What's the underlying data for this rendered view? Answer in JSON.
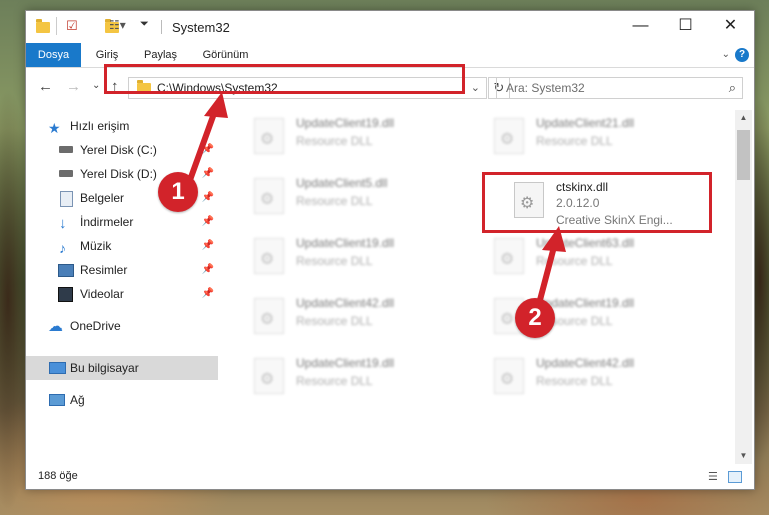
{
  "window": {
    "title": "System32",
    "controls": {
      "minimize": "—",
      "maximize": "☐",
      "close": "✕"
    }
  },
  "ribbon": {
    "tabs": [
      {
        "label": "Dosya",
        "active": true
      },
      {
        "label": "Giriş",
        "active": false
      },
      {
        "label": "Paylaş",
        "active": false
      },
      {
        "label": "Görünüm",
        "active": false
      }
    ],
    "help": "?"
  },
  "nav": {
    "address": "C:\\Windows\\System32",
    "search_placeholder": "Ara: System32"
  },
  "sidebar": {
    "items": [
      {
        "label": "Hızlı erişim",
        "icon": "star-icon",
        "pinned": false
      },
      {
        "label": "Yerel Disk (C:)",
        "icon": "drive-icon",
        "pinned": true
      },
      {
        "label": "Yerel Disk (D:)",
        "icon": "drive-icon",
        "pinned": true
      },
      {
        "label": "Belgeler",
        "icon": "document-icon",
        "pinned": true
      },
      {
        "label": "İndirmeler",
        "icon": "download-icon",
        "pinned": true
      },
      {
        "label": "Müzik",
        "icon": "music-icon",
        "pinned": true
      },
      {
        "label": "Resimler",
        "icon": "pictures-icon",
        "pinned": true
      },
      {
        "label": "Videolar",
        "icon": "video-icon",
        "pinned": true
      },
      {
        "label": "OneDrive",
        "icon": "cloud-icon",
        "pinned": false
      },
      {
        "label": "Bu bilgisayar",
        "icon": "computer-icon",
        "pinned": false,
        "selected": true
      },
      {
        "label": "Ağ",
        "icon": "network-icon",
        "pinned": false
      }
    ]
  },
  "files": [
    {
      "name": "UpdateClient19.dll",
      "type": "Resource DLL",
      "blurred": true
    },
    {
      "name": "UpdateClient21.dll",
      "type": "Resource DLL",
      "blurred": true
    },
    {
      "name": "UpdateClient5.dll",
      "type": "Resource DLL",
      "blurred": true
    },
    {
      "name": "ctskinx.dll",
      "version": "2.0.12.0",
      "description": "Creative SkinX Engi...",
      "blurred": false,
      "highlighted": true
    },
    {
      "name": "UpdateClient19.dll",
      "type": "Resource DLL",
      "blurred": true
    },
    {
      "name": "UpdateClient63.dll",
      "type": "Resource DLL",
      "blurred": true
    },
    {
      "name": "UpdateClient42.dll",
      "type": "Resource DLL",
      "blurred": true
    },
    {
      "name": "UpdateClient19.dll",
      "type": "Resource DLL",
      "blurred": true
    },
    {
      "name": "UpdateClient19.dll",
      "type": "Resource DLL",
      "blurred": true
    },
    {
      "name": "UpdateClient42.dll",
      "type": "Resource DLL",
      "blurred": true
    }
  ],
  "status": {
    "count": "188 öğe"
  },
  "annotations": {
    "step1": "1",
    "step2": "2"
  },
  "colors": {
    "accent": "#1979ca",
    "highlight": "#d2232a"
  }
}
